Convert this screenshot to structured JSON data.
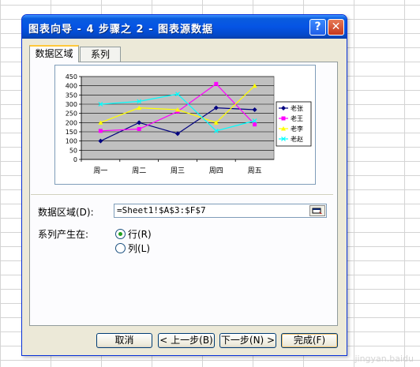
{
  "window": {
    "title": "图表向导 - 4 步骤之 2 - 图表源数据",
    "help_icon": "question-mark",
    "close_icon": "close-x"
  },
  "tabs": [
    {
      "label": "数据区域",
      "active": true
    },
    {
      "label": "系列",
      "active": false
    }
  ],
  "data_range": {
    "label": "数据区域(D):",
    "value": "=Sheet1!$A$3:$F$7"
  },
  "series_in": {
    "label": "系列产生在:",
    "options": [
      {
        "label": "行(R)",
        "selected": true
      },
      {
        "label": "列(L)",
        "selected": false
      }
    ]
  },
  "buttons": {
    "cancel": "取消",
    "back": "< 上一步(B)",
    "next": "下一步(N) >",
    "finish": "完成(F)"
  },
  "chart_data": {
    "type": "line",
    "categories": [
      "周一",
      "周二",
      "周三",
      "周四",
      "周五"
    ],
    "ylim": [
      0,
      450
    ],
    "yticks": [
      0,
      50,
      100,
      150,
      200,
      250,
      300,
      350,
      400,
      450
    ],
    "grid": true,
    "legend": "right",
    "series": [
      {
        "name": "老张",
        "color": "#000080",
        "values": [
          100,
          200,
          140,
          280,
          270
        ]
      },
      {
        "name": "老王",
        "color": "#ff00ff",
        "values": [
          155,
          165,
          260,
          410,
          190
        ]
      },
      {
        "name": "老李",
        "color": "#ffff00",
        "values": [
          200,
          280,
          270,
          200,
          400
        ]
      },
      {
        "name": "老赵",
        "color": "#00ffff",
        "values": [
          300,
          315,
          355,
          155,
          210
        ]
      }
    ]
  },
  "watermark": "jingyan.baidu"
}
